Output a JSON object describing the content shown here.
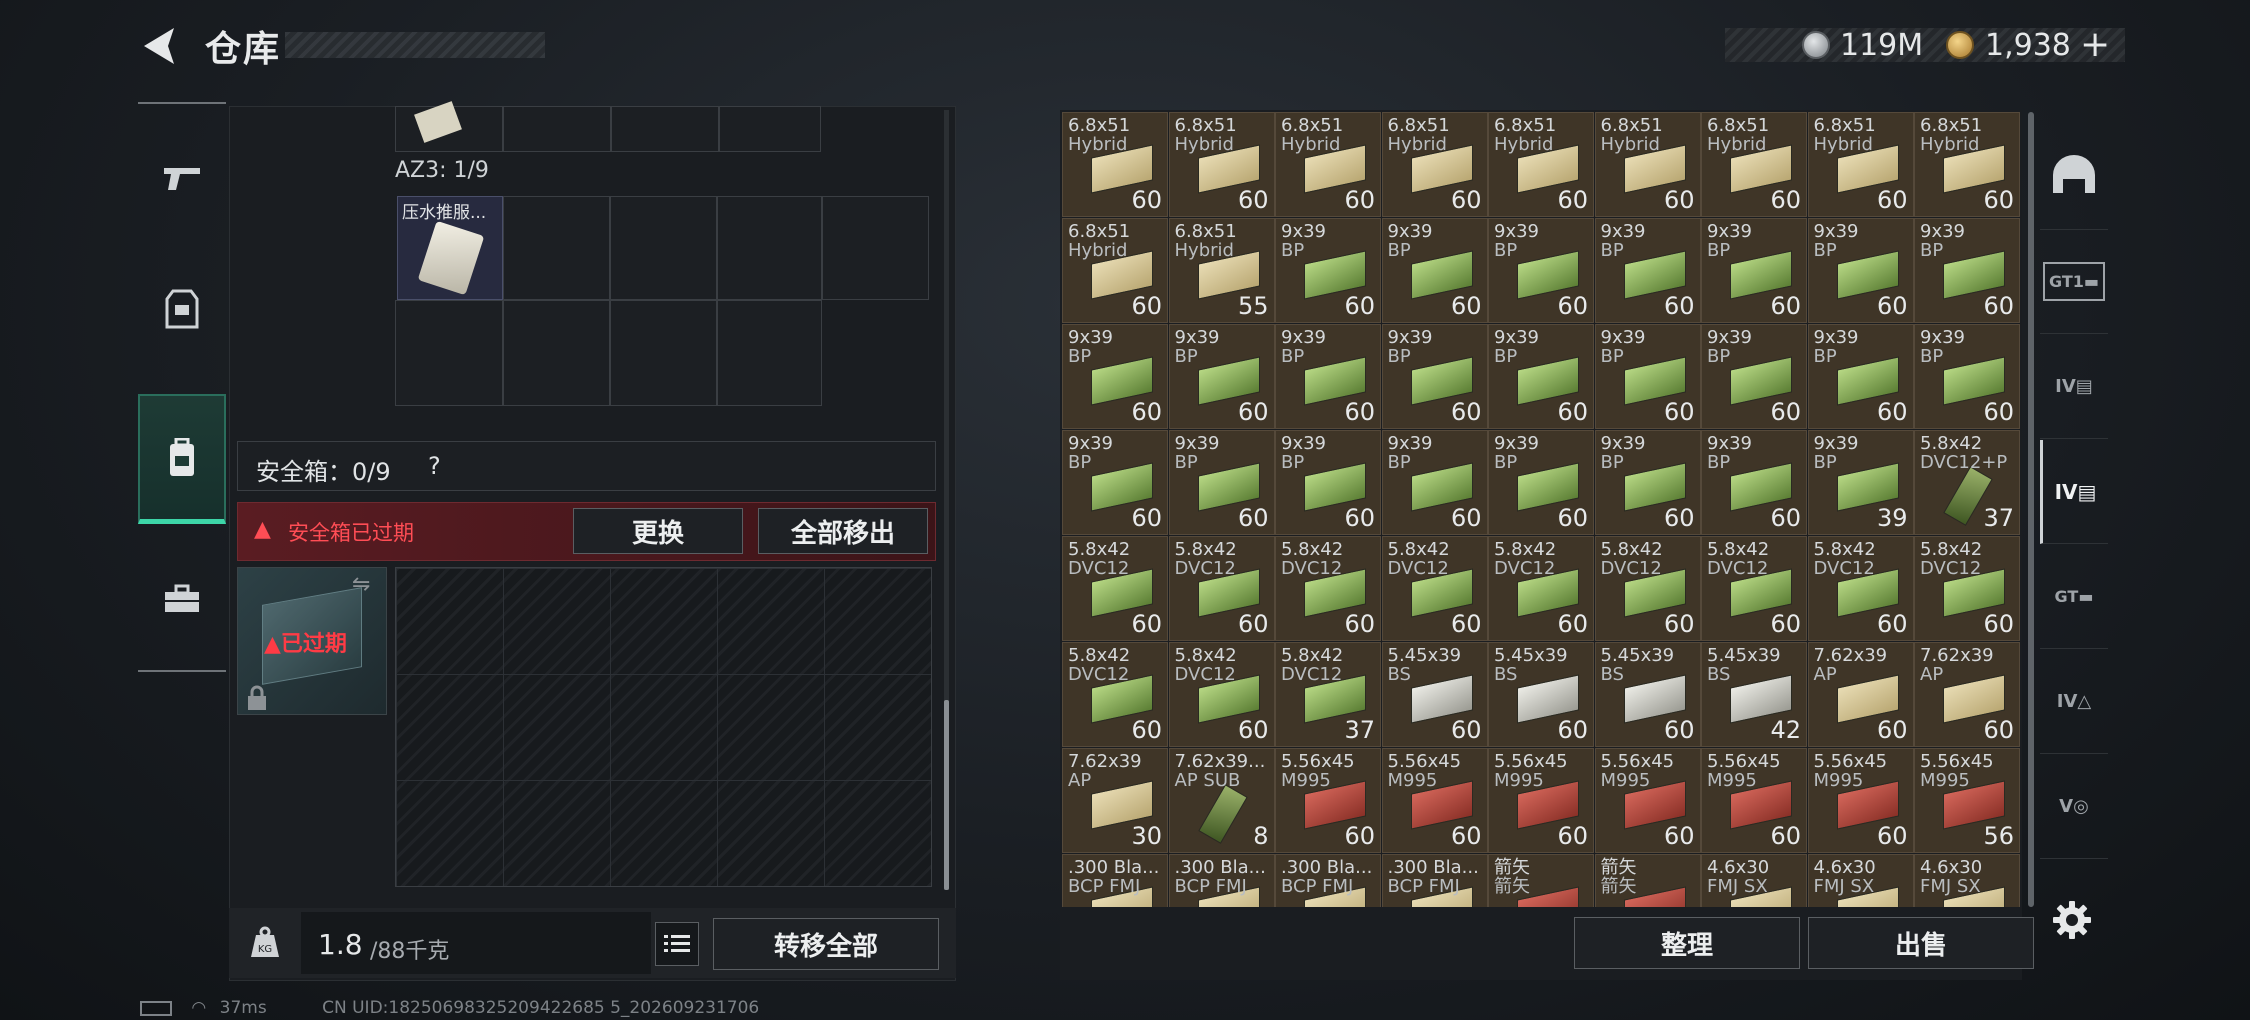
{
  "header": {
    "title": "仓库",
    "money": "119M",
    "gold": "1,938",
    "gold_plus": "+"
  },
  "colors": {
    "accent_green": "#3dd6a8",
    "warning_red": "#ff4d55",
    "item_bg": "#3f3527"
  },
  "left_nav": {
    "items": [
      "pistol-icon",
      "armor-icon",
      "backpack-icon",
      "case-icon"
    ],
    "active": "backpack-icon"
  },
  "container": {
    "az3_label": "AZ3: 1/9",
    "item_name": "压水推服..."
  },
  "safe_box": {
    "label": "安全箱：0/9",
    "help": "?",
    "warning": "安全箱已过期",
    "replace_label": "更换",
    "move_all_label": "全部移出",
    "expired_label": "已过期"
  },
  "weight": {
    "current": "1.8",
    "max": "/88千克"
  },
  "transfer_label": "转移全部",
  "status": {
    "ping": "37ms",
    "uid": "CN UID:18250698325209422685 5_202609231706"
  },
  "grid_actions": {
    "sort_label": "整理",
    "sell_label": "出售"
  },
  "right_tabs": [
    "helmet-icon",
    "gt1-icon",
    "iv-folder-icon",
    "iv-doc-icon",
    "gt-folder-icon",
    "iv-a-icon",
    "v-icon"
  ],
  "items": [
    [
      "6.8x51",
      "Hybrid",
      "60",
      "sand"
    ],
    [
      "6.8x51",
      "Hybrid",
      "60",
      "sand"
    ],
    [
      "6.8x51",
      "Hybrid",
      "60",
      "sand"
    ],
    [
      "6.8x51",
      "Hybrid",
      "60",
      "sand"
    ],
    [
      "6.8x51",
      "Hybrid",
      "60",
      "sand"
    ],
    [
      "6.8x51",
      "Hybrid",
      "60",
      "sand"
    ],
    [
      "6.8x51",
      "Hybrid",
      "60",
      "sand"
    ],
    [
      "6.8x51",
      "Hybrid",
      "60",
      "sand"
    ],
    [
      "6.8x51",
      "Hybrid",
      "60",
      "sand"
    ],
    [
      "6.8x51",
      "Hybrid",
      "60",
      "sand"
    ],
    [
      "6.8x51",
      "Hybrid",
      "55",
      "sand"
    ],
    [
      "9x39",
      "BP",
      "60",
      "green"
    ],
    [
      "9x39",
      "BP",
      "60",
      "green"
    ],
    [
      "9x39",
      "BP",
      "60",
      "green"
    ],
    [
      "9x39",
      "BP",
      "60",
      "green"
    ],
    [
      "9x39",
      "BP",
      "60",
      "green"
    ],
    [
      "9x39",
      "BP",
      "60",
      "green"
    ],
    [
      "9x39",
      "BP",
      "60",
      "green"
    ],
    [
      "9x39",
      "BP",
      "60",
      "green"
    ],
    [
      "9x39",
      "BP",
      "60",
      "green"
    ],
    [
      "9x39",
      "BP",
      "60",
      "green"
    ],
    [
      "9x39",
      "BP",
      "60",
      "green"
    ],
    [
      "9x39",
      "BP",
      "60",
      "green"
    ],
    [
      "9x39",
      "BP",
      "60",
      "green"
    ],
    [
      "9x39",
      "BP",
      "60",
      "green"
    ],
    [
      "9x39",
      "BP",
      "60",
      "green"
    ],
    [
      "9x39",
      "BP",
      "60",
      "green"
    ],
    [
      "9x39",
      "BP",
      "60",
      "green"
    ],
    [
      "9x39",
      "BP",
      "60",
      "green"
    ],
    [
      "9x39",
      "BP",
      "60",
      "green"
    ],
    [
      "9x39",
      "BP",
      "60",
      "green"
    ],
    [
      "9x39",
      "BP",
      "60",
      "green"
    ],
    [
      "9x39",
      "BP",
      "60",
      "green"
    ],
    [
      "9x39",
      "BP",
      "60",
      "green"
    ],
    [
      "9x39",
      "BP",
      "39",
      "green"
    ],
    [
      "5.8x42",
      "DVC12+P",
      "37",
      "mag"
    ],
    [
      "5.8x42",
      "DVC12",
      "60",
      "green"
    ],
    [
      "5.8x42",
      "DVC12",
      "60",
      "green"
    ],
    [
      "5.8x42",
      "DVC12",
      "60",
      "green"
    ],
    [
      "5.8x42",
      "DVC12",
      "60",
      "green"
    ],
    [
      "5.8x42",
      "DVC12",
      "60",
      "green"
    ],
    [
      "5.8x42",
      "DVC12",
      "60",
      "green"
    ],
    [
      "5.8x42",
      "DVC12",
      "60",
      "green"
    ],
    [
      "5.8x42",
      "DVC12",
      "60",
      "green"
    ],
    [
      "5.8x42",
      "DVC12",
      "60",
      "green"
    ],
    [
      "5.8x42",
      "DVC12",
      "60",
      "green"
    ],
    [
      "5.8x42",
      "DVC12",
      "60",
      "green"
    ],
    [
      "5.8x42",
      "DVC12",
      "37",
      "green"
    ],
    [
      "5.45x39",
      "BS",
      "60",
      "white"
    ],
    [
      "5.45x39",
      "BS",
      "60",
      "white"
    ],
    [
      "5.45x39",
      "BS",
      "60",
      "white"
    ],
    [
      "5.45x39",
      "BS",
      "42",
      "white"
    ],
    [
      "7.62x39",
      "AP",
      "60",
      "sand"
    ],
    [
      "7.62x39",
      "AP",
      "60",
      "sand"
    ],
    [
      "7.62x39",
      "AP",
      "30",
      "sand"
    ],
    [
      "7.62x39...",
      "AP SUB",
      "8",
      "mag"
    ],
    [
      "5.56x45",
      "M995",
      "60",
      "red"
    ],
    [
      "5.56x45",
      "M995",
      "60",
      "red"
    ],
    [
      "5.56x45",
      "M995",
      "60",
      "red"
    ],
    [
      "5.56x45",
      "M995",
      "60",
      "red"
    ],
    [
      "5.56x45",
      "M995",
      "60",
      "red"
    ],
    [
      "5.56x45",
      "M995",
      "60",
      "red"
    ],
    [
      "5.56x45",
      "M995",
      "56",
      "red"
    ],
    [
      ".300 Bla...",
      "BCP FMJ",
      "",
      "sand"
    ],
    [
      ".300 Bla...",
      "BCP FMJ",
      "",
      "sand"
    ],
    [
      ".300 Bla...",
      "BCP FMJ",
      "",
      "sand"
    ],
    [
      ".300 Bla...",
      "BCP FMJ",
      "",
      "sand"
    ],
    [
      "箭矢",
      "箭矢",
      "",
      "red"
    ],
    [
      "箭矢",
      "箭矢",
      "",
      "red"
    ],
    [
      "4.6x30",
      "FMJ SX",
      "",
      "sand"
    ],
    [
      "4.6x30",
      "FMJ SX",
      "",
      "sand"
    ],
    [
      "4.6x30",
      "FMJ SX",
      "",
      "sand"
    ]
  ]
}
